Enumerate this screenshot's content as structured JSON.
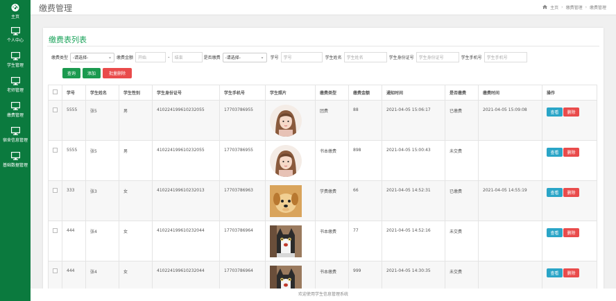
{
  "sidebar": {
    "items": [
      {
        "label": "主页",
        "icon": "dashboard-icon"
      },
      {
        "label": "个人中心",
        "icon": "monitor-icon"
      },
      {
        "label": "学生管理",
        "icon": "monitor-icon"
      },
      {
        "label": "老师管理",
        "icon": "monitor-icon"
      },
      {
        "label": "缴费管理",
        "icon": "monitor-icon"
      },
      {
        "label": "宿舍信息管理",
        "icon": "monitor-icon"
      },
      {
        "label": "基础数据管理",
        "icon": "monitor-icon"
      }
    ]
  },
  "header": {
    "title": "缴费管理",
    "breadcrumb": [
      "主页",
      "缴费管理",
      "缴费管理"
    ]
  },
  "panel": {
    "title": "缴费表列表"
  },
  "filters": {
    "fee_type_label": "缴费类型",
    "fee_type_value": "-请选择-",
    "amount_label": "缴费金额",
    "amount_start_placeholder": "开始",
    "amount_dash": "-",
    "amount_end_placeholder": "结束",
    "paid_label": "是否缴费",
    "paid_value": "-请选择-",
    "student_no_label": "学号",
    "student_no_placeholder": "学号",
    "student_name_label": "学生姓名",
    "student_name_placeholder": "学生姓名",
    "id_card_label": "学生身份证号",
    "id_card_placeholder": "学生身份证号",
    "phone_label": "学生手机号",
    "phone_placeholder": "学生手机号"
  },
  "actions": {
    "query": "查询",
    "add": "添加",
    "batch_delete": "批量删除"
  },
  "table": {
    "headers": [
      "学号",
      "学生姓名",
      "学生性别",
      "学生身份证号",
      "学生手机号",
      "学生照片",
      "缴费类型",
      "缴费金额",
      "通知时间",
      "是否缴费",
      "缴费时间",
      "操作"
    ],
    "view_label": "查看",
    "delete_label": "删除",
    "rows": [
      {
        "no": "5555",
        "name": "张5",
        "gender": "男",
        "id_card": "410224199610232055",
        "phone": "17703786955",
        "photo": "girl",
        "type": "团费",
        "amount": "88",
        "notify": "2021-04-05 15:06:17",
        "paid": "已缴费",
        "paid_time": "2021-04-05 15:09:08"
      },
      {
        "no": "5555",
        "name": "张5",
        "gender": "男",
        "id_card": "410224199610232055",
        "phone": "17703786955",
        "photo": "girl",
        "type": "书本缴费",
        "amount": "898",
        "notify": "2021-04-05 15:00:43",
        "paid": "未交费",
        "paid_time": ""
      },
      {
        "no": "333",
        "name": "张3",
        "gender": "女",
        "id_card": "410224199610232013",
        "phone": "17703786963",
        "photo": "puppy",
        "type": "学费缴费",
        "amount": "66",
        "notify": "2021-04-05 14:52:31",
        "paid": "已缴费",
        "paid_time": "2021-04-05 14:55:19"
      },
      {
        "no": "444",
        "name": "张4",
        "gender": "女",
        "id_card": "410224199610232044",
        "phone": "17703786964",
        "photo": "cat",
        "type": "书本缴费",
        "amount": "77",
        "notify": "2021-04-05 14:52:16",
        "paid": "未交费",
        "paid_time": ""
      },
      {
        "no": "444",
        "name": "张4",
        "gender": "女",
        "id_card": "410224199610232044",
        "phone": "17703786964",
        "photo": "cat",
        "type": "书本缴费",
        "amount": "999",
        "notify": "2021-04-05 14:30:35",
        "paid": "未交费",
        "paid_time": ""
      }
    ]
  },
  "footer": {
    "text": "欢迎使用学生信息管理系统"
  },
  "colors": {
    "sidebar": "#0b7a3e",
    "accent": "#1aa35a",
    "danger": "#e94b4b",
    "info": "#2aa5c7"
  }
}
